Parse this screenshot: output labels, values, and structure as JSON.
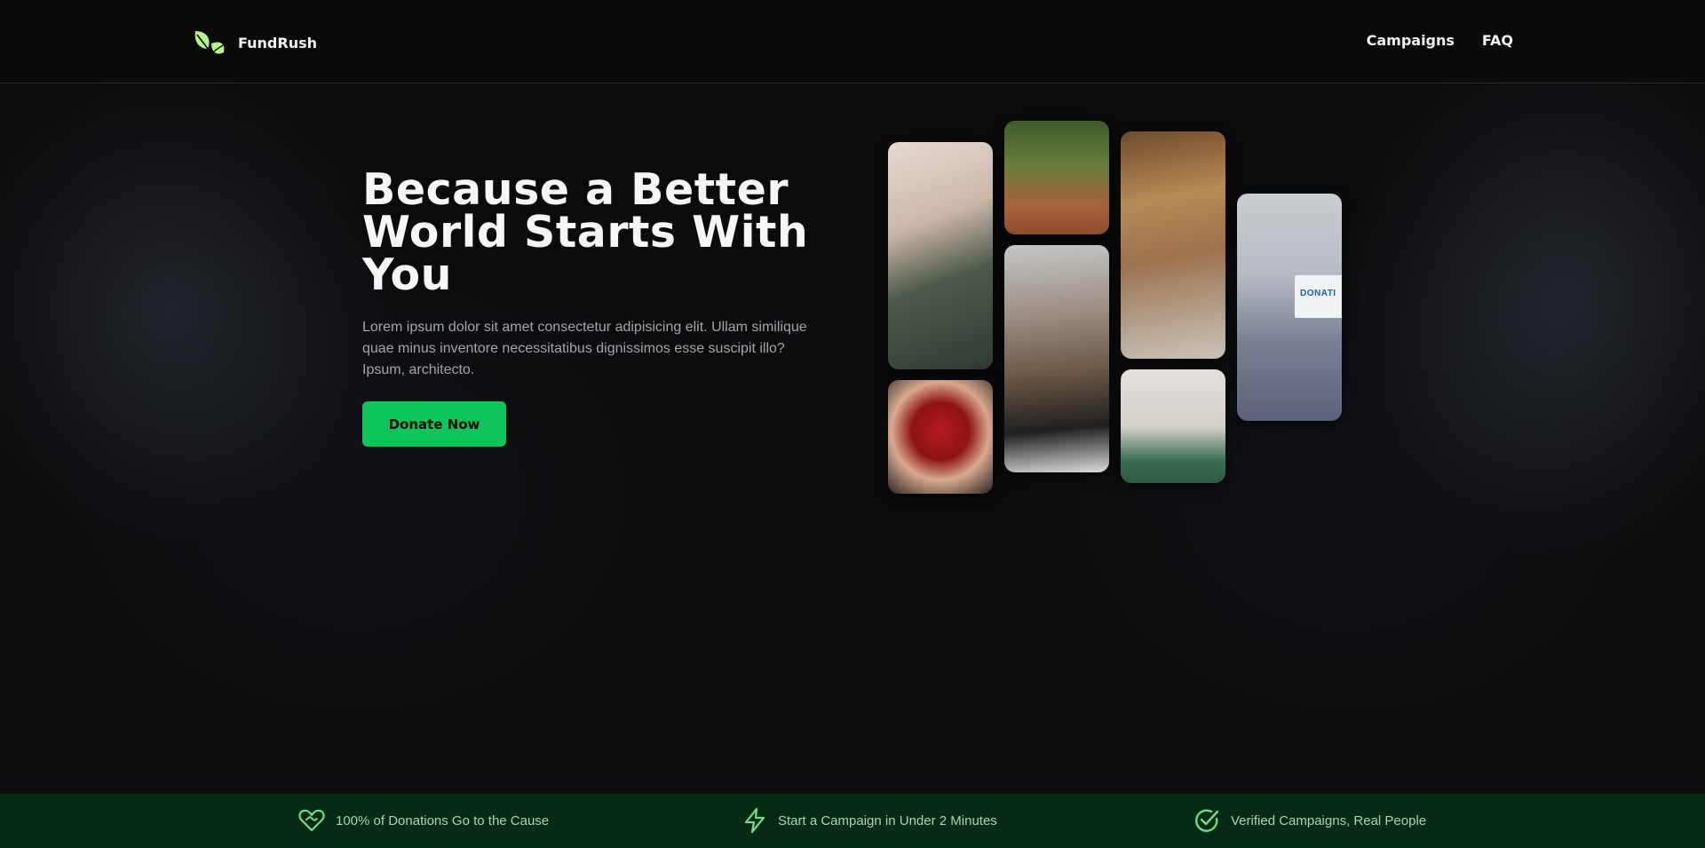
{
  "header": {
    "brand": "FundRush",
    "nav": [
      {
        "label": "Campaigns"
      },
      {
        "label": "FAQ"
      }
    ]
  },
  "hero": {
    "title": "Because a Better World Starts With You",
    "description": "Lorem ipsum dolor sit amet consectetur adipisicing elit. Ullam similique quae minus inventore necessitatibus dignissimos esse suscipit illo? Ipsum, architecto.",
    "cta_label": "Donate Now",
    "donation_box_text": "DONATI"
  },
  "features": [
    {
      "icon": "heart-handshake-icon",
      "label": "100% of Donations Go to the Cause"
    },
    {
      "icon": "lightning-icon",
      "label": "Start a Campaign in Under 2 Minutes"
    },
    {
      "icon": "check-circle-icon",
      "label": "Verified Campaigns, Real People"
    }
  ],
  "colors": {
    "accent": "#0fc45a",
    "feature_bar": "#072a14",
    "feature_text": "#a8d5b6",
    "logo_leaf": "#b8f28c"
  }
}
